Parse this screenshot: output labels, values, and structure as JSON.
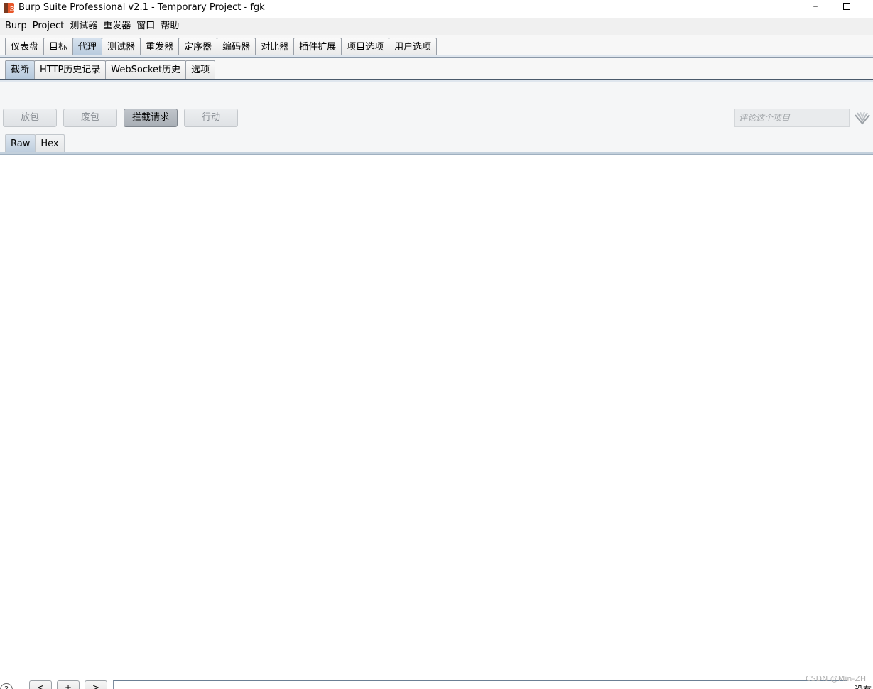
{
  "window": {
    "title": "Burp Suite Professional v2.1 - Temporary Project - fgk",
    "minimize_glyph": "–"
  },
  "menu": [
    "Burp",
    "Project",
    "测试器",
    "重发器",
    "窗口",
    "帮助"
  ],
  "main_tabs": [
    {
      "label": "仪表盘",
      "active": false
    },
    {
      "label": "目标",
      "active": false
    },
    {
      "label": "代理",
      "active": true
    },
    {
      "label": "测试器",
      "active": false
    },
    {
      "label": "重发器",
      "active": false
    },
    {
      "label": "定序器",
      "active": false
    },
    {
      "label": "编码器",
      "active": false
    },
    {
      "label": "对比器",
      "active": false
    },
    {
      "label": "插件扩展",
      "active": false
    },
    {
      "label": "项目选项",
      "active": false
    },
    {
      "label": "用户选项",
      "active": false
    }
  ],
  "sub_tabs": [
    {
      "label": "截断",
      "active": true
    },
    {
      "label": "HTTP历史记录",
      "active": false
    },
    {
      "label": "WebSocket历史",
      "active": false
    },
    {
      "label": "选项",
      "active": false
    }
  ],
  "intercept": {
    "forward_label": "放包",
    "drop_label": "废包",
    "intercept_label": "拦截请求",
    "action_label": "行动",
    "comment_placeholder": "评论这个项目",
    "intercept_on": true
  },
  "view_tabs": [
    {
      "label": "Raw",
      "active": true
    },
    {
      "label": "Hex",
      "active": false
    }
  ],
  "bottom": {
    "help_glyph": "?",
    "prev_label": "<",
    "next_plus_label": "+",
    "next_label": ">",
    "search_value": "",
    "match_text": "没有",
    "watermark": "CSDN @Min-ZH"
  },
  "icons": {
    "app_logo": "burp-logo-icon",
    "highlight": "highlight-icon"
  },
  "colors": {
    "active_tab": "#b6c9dc",
    "logo_orange": "#e8572a"
  }
}
